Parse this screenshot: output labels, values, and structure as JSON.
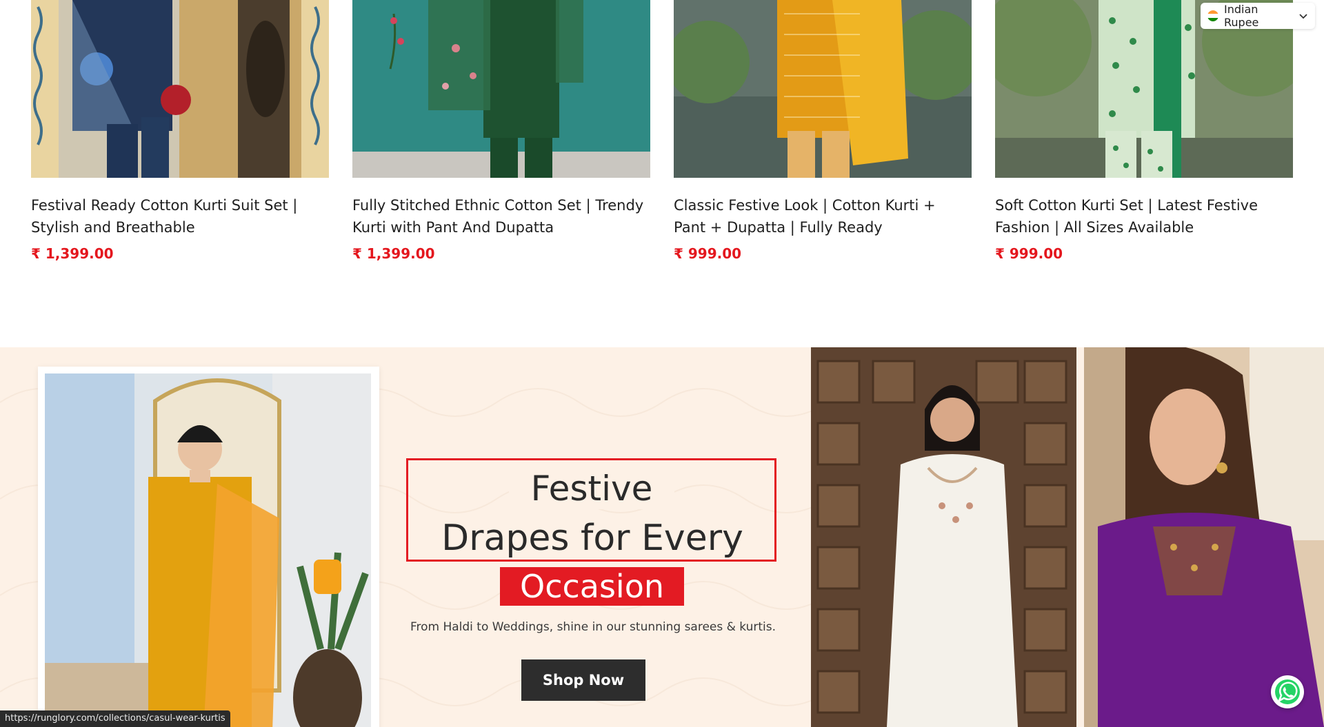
{
  "products": [
    {
      "title": "Festival Ready Cotton Kurti Suit Set | Stylish and Breathable",
      "price": "₹ 1,399.00"
    },
    {
      "title": "Fully Stitched Ethnic Cotton Set | Trendy Kurti with Pant And Dupatta",
      "price": "₹ 1,399.00"
    },
    {
      "title": "Classic Festive Look | Cotton Kurti + Pant + Dupatta | Fully Ready",
      "price": "₹ 999.00"
    },
    {
      "title": "Soft Cotton Kurti Set | Latest Festive Fashion | All Sizes Available",
      "price": "₹ 999.00"
    }
  ],
  "currency": {
    "label": "Indian Rupee",
    "flag_icon": "india-flag-icon"
  },
  "banner": {
    "headline_line1": "Festive",
    "headline_line2": "Drapes for Every",
    "headline_highlight": "Occasion",
    "subtitle": "From Haldi to Weddings, shine in our stunning sarees & kurtis.",
    "cta_label": "Shop Now"
  },
  "status_bar": {
    "url": "https://runglory.com/collections/casul-wear-kurtis"
  },
  "colors": {
    "accent_red": "#e31b23",
    "price_red": "#e4171e",
    "banner_bg": "#fdf1e6",
    "button_dark": "#2d2d2d",
    "whatsapp_green": "#25d366"
  }
}
